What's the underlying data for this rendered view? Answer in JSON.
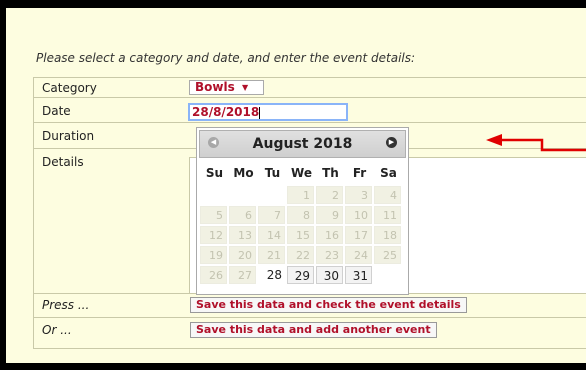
{
  "intro": "Please select a category and date, and enter the event details:",
  "form": {
    "category_label": "Category",
    "category_value": "Bowls",
    "date_label": "Date",
    "date_value": "28/8/2018",
    "duration_label": "Duration",
    "details_label": "Details",
    "press_label": "Press ...",
    "or_label": "Or ...",
    "save_check_button": "Save this data and check the event details",
    "save_add_button": "Save this data and add another event"
  },
  "calendar": {
    "title": "August 2018",
    "weekdays": [
      "Su",
      "Mo",
      "Tu",
      "We",
      "Th",
      "Fr",
      "Sa"
    ],
    "weeks": [
      [
        "",
        "",
        "",
        "1",
        "2",
        "3",
        "4"
      ],
      [
        "5",
        "6",
        "7",
        "8",
        "9",
        "10",
        "11"
      ],
      [
        "12",
        "13",
        "14",
        "15",
        "16",
        "17",
        "18"
      ],
      [
        "19",
        "20",
        "21",
        "22",
        "23",
        "24",
        "25"
      ],
      [
        "26",
        "27",
        "28",
        "29",
        "30",
        "31",
        ""
      ]
    ],
    "first_selectable_day": 28,
    "selected_day": 28
  },
  "colors": {
    "background": "#fdfde0",
    "accent_text": "#b0102a",
    "annotation_arrow": "#e00000"
  }
}
